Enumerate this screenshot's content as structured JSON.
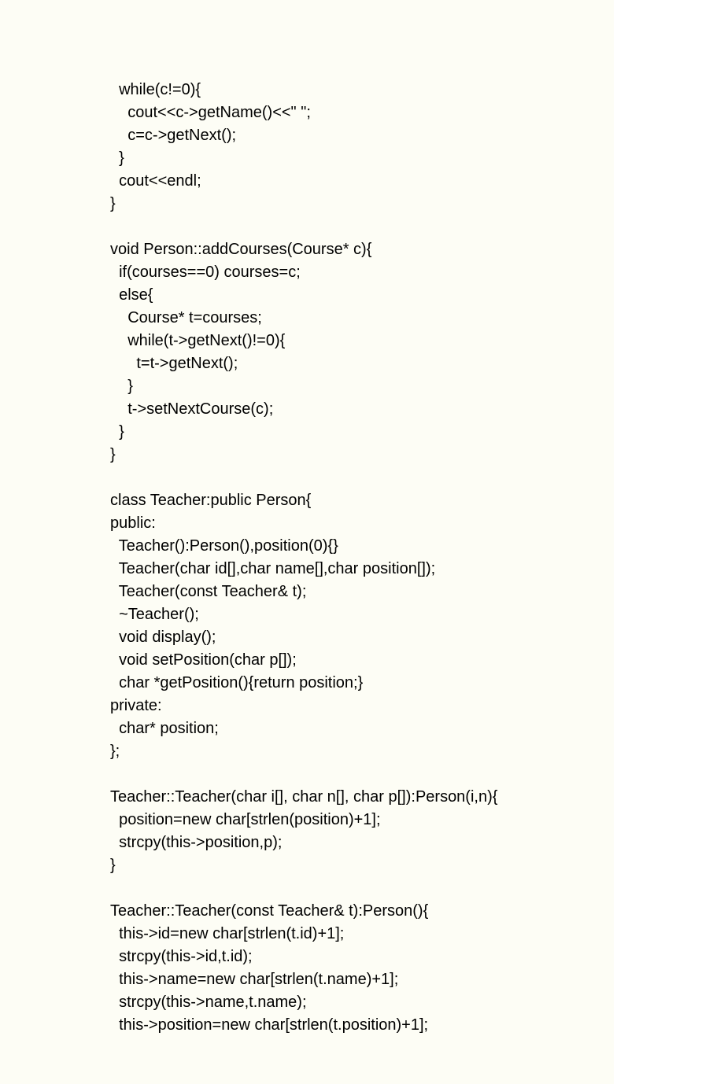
{
  "code": {
    "lines": [
      "  while(c!=0){",
      "    cout<<c->getName()<<\" \";",
      "    c=c->getNext();",
      "  }",
      "  cout<<endl;",
      "}",
      "",
      "void Person::addCourses(Course* c){",
      "  if(courses==0) courses=c;",
      "  else{",
      "    Course* t=courses;",
      "    while(t->getNext()!=0){",
      "      t=t->getNext();",
      "    }",
      "    t->setNextCourse(c);",
      "  }",
      "}",
      "",
      "class Teacher:public Person{",
      "public:",
      "  Teacher():Person(),position(0){}",
      "  Teacher(char id[],char name[],char position[]);",
      "  Teacher(const Teacher& t);",
      "  ~Teacher();",
      "  void display();",
      "  void setPosition(char p[]);",
      "  char *getPosition(){return position;}",
      "private:",
      "  char* position;",
      "};",
      "",
      "Teacher::Teacher(char i[], char n[], char p[]):Person(i,n){",
      "  position=new char[strlen(position)+1];",
      "  strcpy(this->position,p);",
      "}",
      "",
      "Teacher::Teacher(const Teacher& t):Person(){",
      "  this->id=new char[strlen(t.id)+1];",
      "  strcpy(this->id,t.id);",
      "  this->name=new char[strlen(t.name)+1];",
      "  strcpy(this->name,t.name);",
      "  this->position=new char[strlen(t.position)+1];"
    ]
  }
}
